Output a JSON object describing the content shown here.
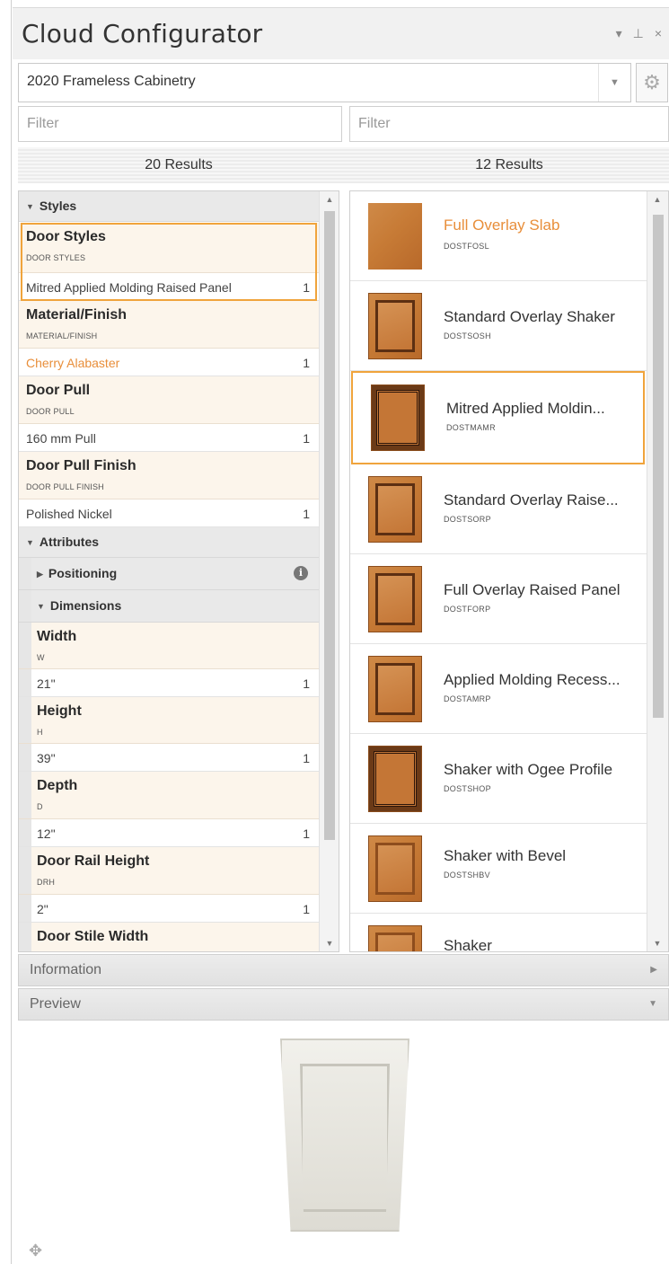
{
  "window": {
    "title": "Cloud Configurator",
    "controls": [
      "▾",
      "⊥",
      "×"
    ]
  },
  "catalog": {
    "selected": "2020 Frameless Cabinetry"
  },
  "filters": {
    "left_placeholder": "Filter",
    "right_placeholder": "Filter"
  },
  "results": {
    "left": "20 Results",
    "right": "12 Results"
  },
  "left_list": {
    "styles_header": "Styles",
    "attributes_header": "Attributes",
    "positioning_header": "Positioning",
    "dimensions_header": "Dimensions",
    "items": [
      {
        "name": "Door Styles",
        "code": "DOOR STYLES",
        "value": "Mitred Applied Molding Raised Panel",
        "count": "1"
      },
      {
        "name": "Material/Finish",
        "code": "MATERIAL/FINISH",
        "value": "Cherry Alabaster",
        "count": "1"
      },
      {
        "name": "Door Pull",
        "code": "DOOR PULL",
        "value": "160 mm Pull",
        "count": "1"
      },
      {
        "name": "Door Pull Finish",
        "code": "DOOR PULL FINISH",
        "value": "Polished Nickel",
        "count": "1"
      }
    ],
    "dimensions": [
      {
        "name": "Width",
        "code": "W",
        "value": "21\"",
        "count": "1"
      },
      {
        "name": "Height",
        "code": "H",
        "value": "39\"",
        "count": "1"
      },
      {
        "name": "Depth",
        "code": "D",
        "value": "12\"",
        "count": "1"
      },
      {
        "name": "Door Rail Height",
        "code": "DRH",
        "value": "2\"",
        "count": "1"
      },
      {
        "name": "Door Stile Width",
        "code": "",
        "value": "",
        "count": ""
      }
    ]
  },
  "right_list": {
    "items": [
      {
        "name": "Full Overlay Slab",
        "code": "DOSTFOSL"
      },
      {
        "name": "Standard Overlay Shaker",
        "code": "DOSTSOSH"
      },
      {
        "name": "Mitred Applied Moldin...",
        "code": "DOSTMAMR"
      },
      {
        "name": "Standard Overlay Raise...",
        "code": "DOSTSORP"
      },
      {
        "name": "Full Overlay Raised Panel",
        "code": "DOSTFORP"
      },
      {
        "name": "Applied Molding Recess...",
        "code": "DOSTAMRP"
      },
      {
        "name": "Shaker with Ogee Profile",
        "code": "DOSTSHOP"
      },
      {
        "name": "Shaker with Bevel",
        "code": "DOSTSHBV"
      },
      {
        "name": "Shaker",
        "code": ""
      }
    ]
  },
  "sections": {
    "information": "Information",
    "preview": "Preview"
  },
  "colors": {
    "accent": "#f0a43c",
    "accent_text": "#e88e3a",
    "attr_bg": "#fcf5eb"
  }
}
